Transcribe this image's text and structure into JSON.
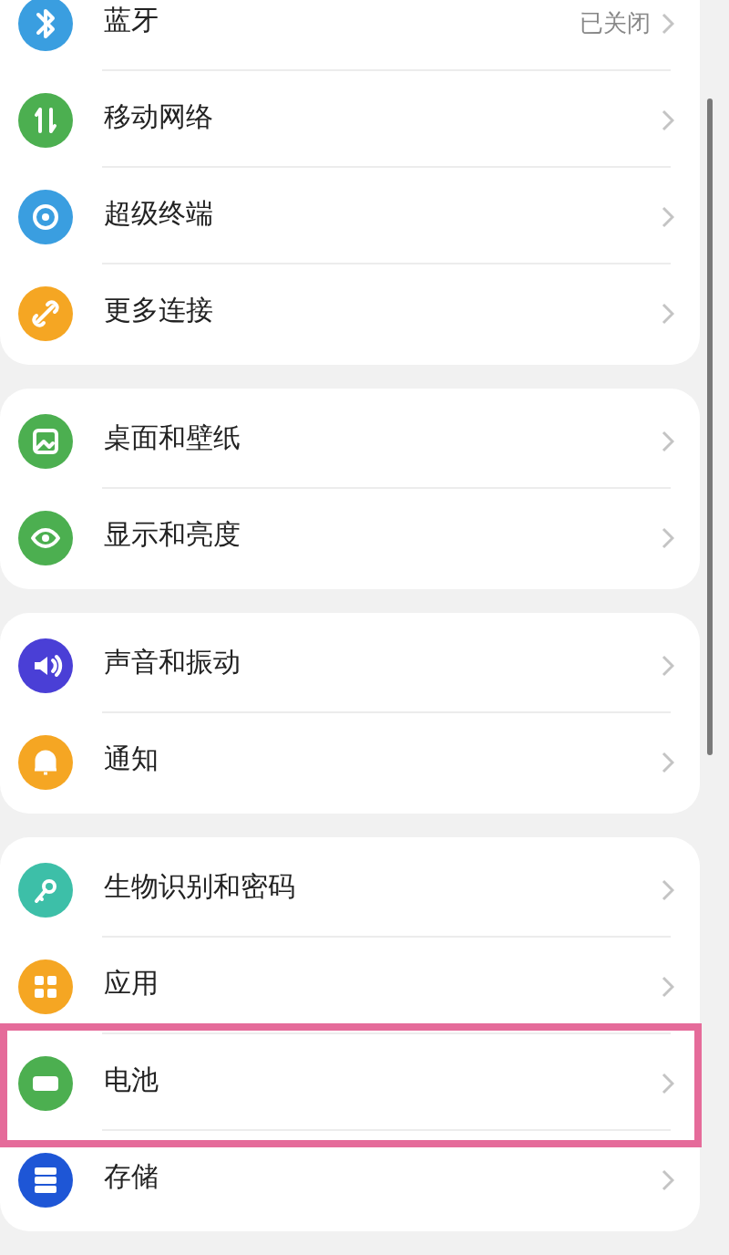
{
  "groups": [
    {
      "items": [
        {
          "label": "蓝牙",
          "value": "已关闭",
          "color": "#3a9ee0",
          "highlighted": false
        },
        {
          "label": "移动网络",
          "color": "#4caf50",
          "highlighted": false
        },
        {
          "label": "超级终端",
          "color": "#3a9ee0",
          "highlighted": false
        },
        {
          "label": "更多连接",
          "color": "#f5a623",
          "highlighted": false
        }
      ]
    },
    {
      "items": [
        {
          "label": "桌面和壁纸",
          "color": "#4caf50",
          "highlighted": false
        },
        {
          "label": "显示和亮度",
          "color": "#4caf50",
          "highlighted": false
        }
      ]
    },
    {
      "items": [
        {
          "label": "声音和振动",
          "color": "#4a3fd6",
          "highlighted": false
        },
        {
          "label": "通知",
          "color": "#f5a623",
          "highlighted": false
        }
      ]
    },
    {
      "items": [
        {
          "label": "生物识别和密码",
          "color": "#3dbfa8",
          "highlighted": false
        },
        {
          "label": "应用",
          "color": "#f5a623",
          "highlighted": false
        },
        {
          "label": "电池",
          "color": "#4caf50",
          "highlighted": true
        },
        {
          "label": "存储",
          "color": "#1e56d6",
          "highlighted": false
        }
      ]
    }
  ]
}
